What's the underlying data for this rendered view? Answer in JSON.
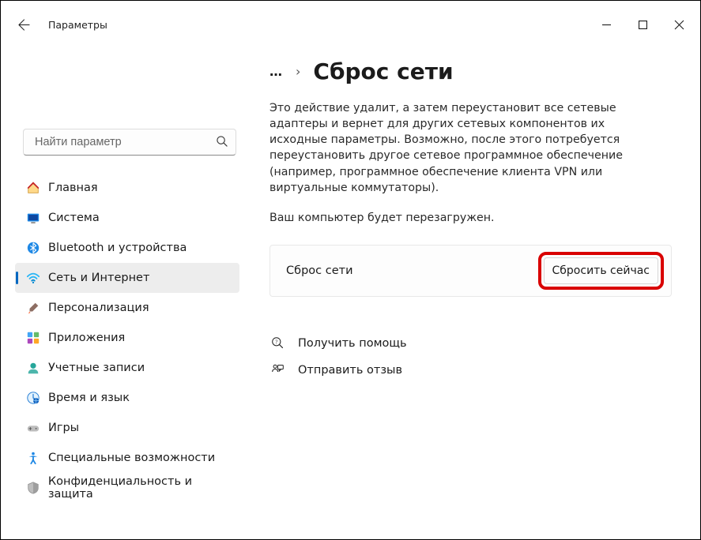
{
  "titlebar": {
    "title": "Параметры"
  },
  "search": {
    "placeholder": "Найти параметр"
  },
  "sidebar": {
    "items": [
      {
        "label": "Главная"
      },
      {
        "label": "Система"
      },
      {
        "label": "Bluetooth и устройства"
      },
      {
        "label": "Сеть и Интернет"
      },
      {
        "label": "Персонализация"
      },
      {
        "label": "Приложения"
      },
      {
        "label": "Учетные записи"
      },
      {
        "label": "Время и язык"
      },
      {
        "label": "Игры"
      },
      {
        "label": "Специальные возможности"
      },
      {
        "label": "Конфиденциальность и защита"
      }
    ]
  },
  "breadcrumb": {
    "ellipsis": "…",
    "sep": "›",
    "title": "Сброс сети"
  },
  "main": {
    "description": "Это действие удалит, а затем переустановит все сетевые адаптеры и вернет для других сетевых компонентов их исходные параметры. Возможно, после этого потребуется переустановить другое сетевое программное обеспечение (например, программное обеспечение клиента VPN или виртуальные коммутаторы).",
    "note": "Ваш компьютер будет перезагружен.",
    "card_label": "Сброс сети",
    "reset_button": "Сбросить сейчас"
  },
  "links": {
    "help": "Получить помощь",
    "feedback": "Отправить отзыв"
  }
}
